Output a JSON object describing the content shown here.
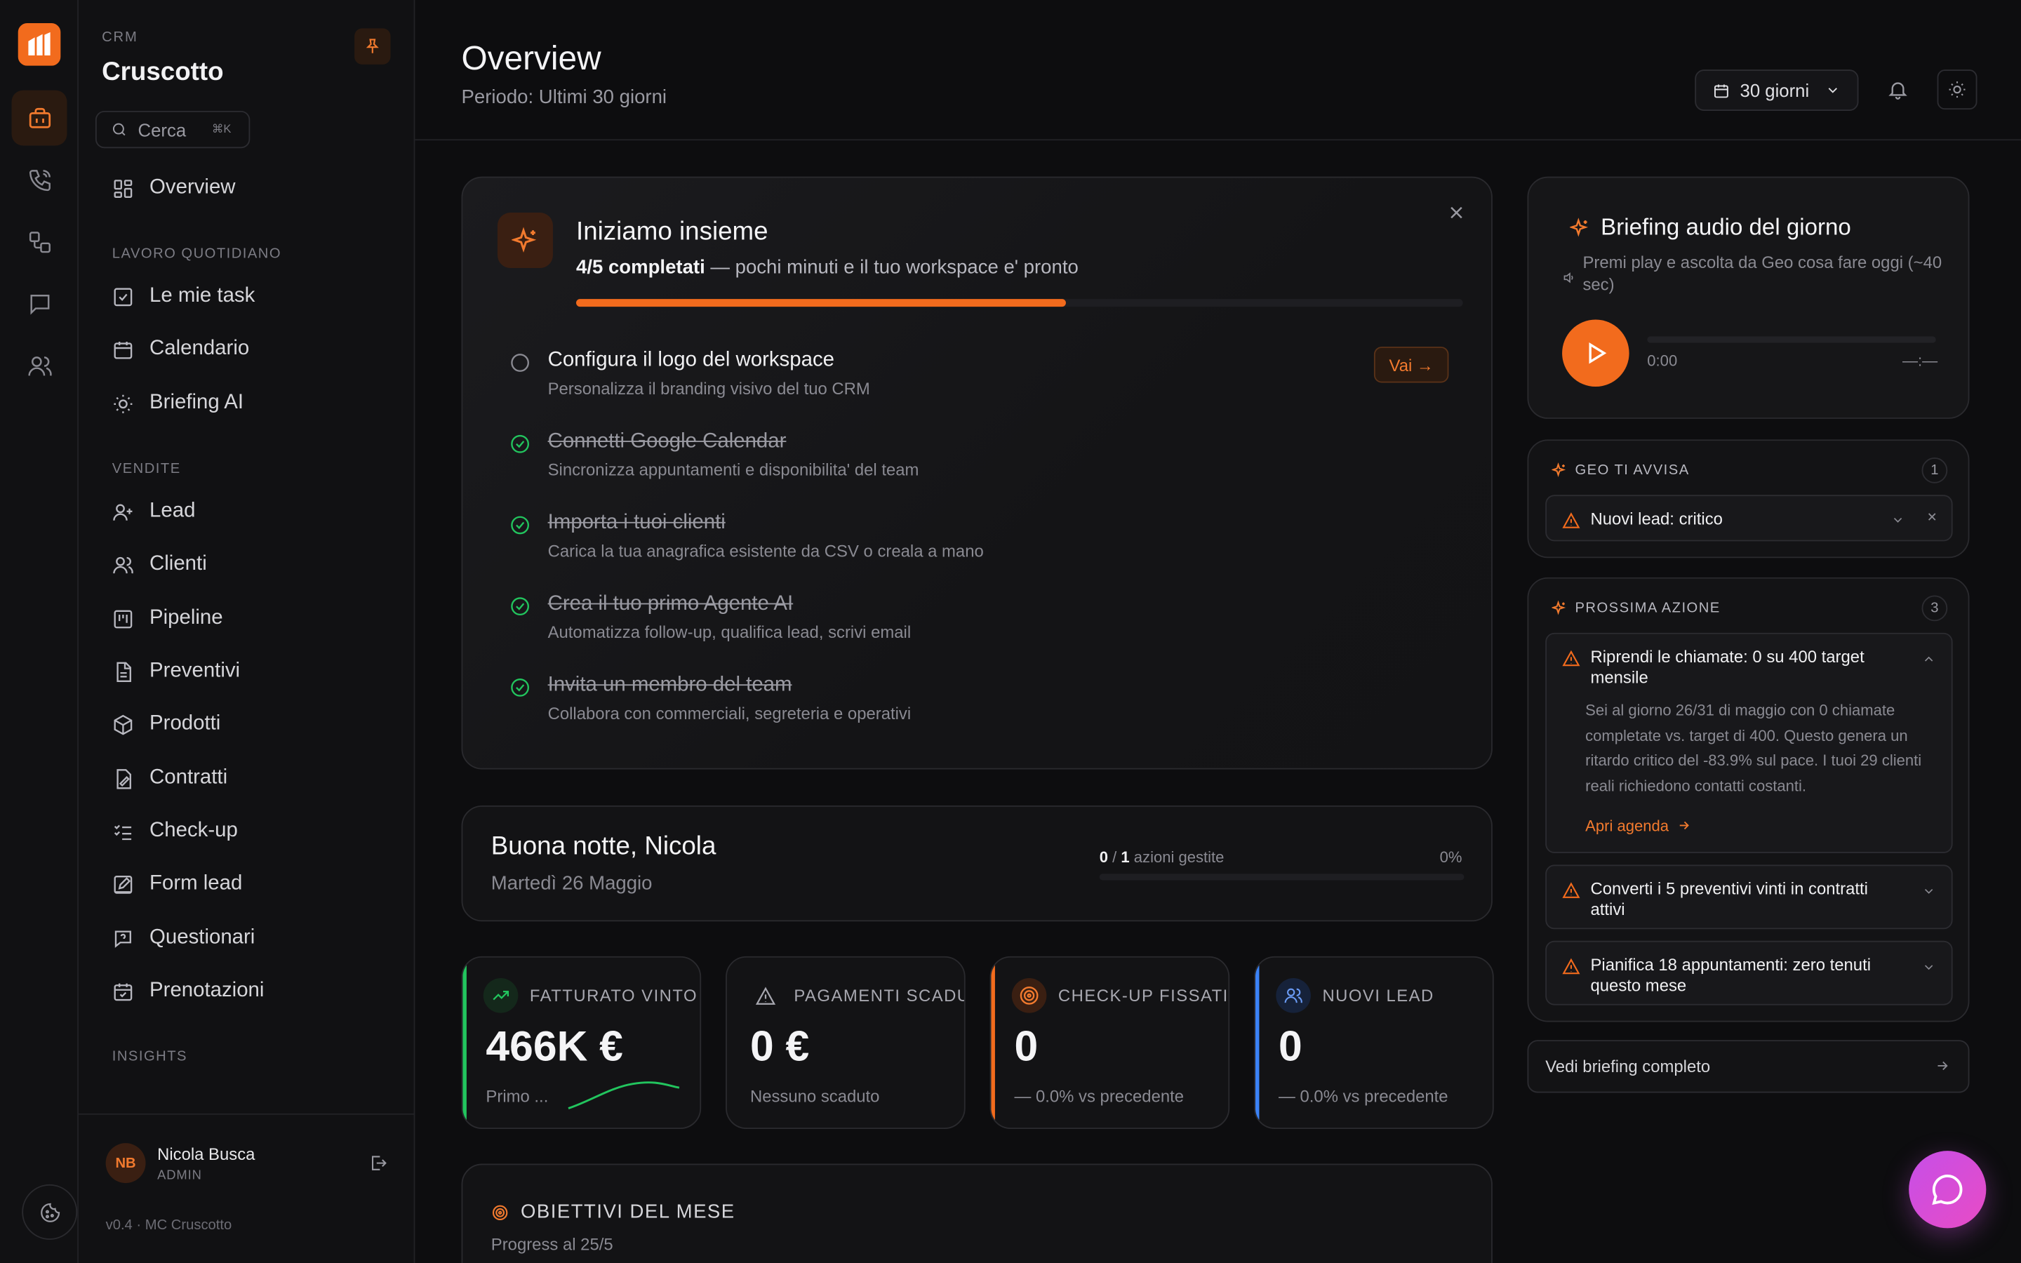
{
  "sidebar": {
    "section_label": "CRM",
    "title": "Cruscotto",
    "search_placeholder": "Cerca",
    "search_shortcut": "⌘K",
    "overview": "Overview",
    "group_daily": "LAVORO QUOTIDIANO",
    "daily": [
      "Le mie task",
      "Calendario",
      "Briefing AI"
    ],
    "group_sales": "VENDITE",
    "sales": [
      "Lead",
      "Clienti",
      "Pipeline",
      "Preventivi",
      "Prodotti",
      "Contratti",
      "Check-up",
      "Form lead",
      "Questionari",
      "Prenotazioni"
    ],
    "group_insights": "INSIGHTS",
    "user": {
      "initials": "NB",
      "name": "Nicola Busca",
      "role": "ADMIN"
    },
    "version": "v0.4 · MC Cruscotto"
  },
  "header": {
    "title": "Overview",
    "subtitle": "Periodo: Ultimi 30 giorni",
    "range": "30 giorni"
  },
  "onboarding": {
    "title": "Iniziamo insieme",
    "progress_bold": "4/5 completati",
    "progress_rest": " — pochi minuti e il tuo workspace e' pronto",
    "progress": 0.8,
    "go_label": "Vai →",
    "steps": [
      {
        "title": "Configura il logo del workspace",
        "desc": "Personalizza il branding visivo del tuo CRM",
        "done": false
      },
      {
        "title": "Connetti Google Calendar",
        "desc": "Sincronizza appuntamenti e disponibilita' del team",
        "done": true
      },
      {
        "title": "Importa i tuoi clienti",
        "desc": "Carica la tua anagrafica esistente da CSV o creala a mano",
        "done": true
      },
      {
        "title": "Crea il tuo primo Agente AI",
        "desc": "Automatizza follow-up, qualifica lead, scrivi email",
        "done": true
      },
      {
        "title": "Invita un membro del team",
        "desc": "Collabora con commerciali, segreteria e operativi",
        "done": true
      }
    ]
  },
  "greeting": {
    "title": "Buona notte, Nicola",
    "date": "Martedì 26 Maggio",
    "done": "0",
    "sep": " / ",
    "total": "1",
    "label": " azioni gestite",
    "pct": "0%"
  },
  "kpis": [
    {
      "label": "FATTURATO VINTO",
      "value": "466K €",
      "foot": "Primo ...",
      "accent": "#22c55e"
    },
    {
      "label": "PAGAMENTI SCADUTI",
      "value": "0 €",
      "foot": "Nessuno scaduto",
      "accent": ""
    },
    {
      "label": "CHECK-UP FISSATI",
      "value": "0",
      "foot": "—  0.0%   vs precedente",
      "accent": "#f26b1d"
    },
    {
      "label": "NUOVI LEAD",
      "value": "0",
      "foot": "—  0.0%   vs precedente",
      "accent": "#3b82f6"
    }
  ],
  "objectives": {
    "title": "OBIETTIVI DEL MESE",
    "subtitle": "Progress al 25/5"
  },
  "briefing": {
    "title": "Briefing audio del giorno",
    "subtitle": "Premi play e ascolta da Geo cosa fare oggi (~40 sec)",
    "time_start": "0:00",
    "time_end": "—:—"
  },
  "geo": {
    "title": "GEO TI AVVISA",
    "count": "1",
    "alert": "Nuovi lead: critico"
  },
  "next": {
    "title": "PROSSIMA AZIONE",
    "count": "3",
    "items": [
      {
        "title": "Riprendi le chiamate: 0 su 400 target mensile",
        "body": "Sei al giorno 26/31 di maggio con 0 chiamate completate vs. target di 400. Questo genera un ritardo critico del -83.9% sul pace. I tuoi 29 clienti reali richiedono contatti costanti.",
        "link": "Apri agenda"
      },
      {
        "title": "Converti i 5 preventivi vinti in contratti attivi"
      },
      {
        "title": "Pianifica 18 appuntamenti: zero tenuti questo mese"
      }
    ]
  },
  "full_briefing": "Vedi briefing completo"
}
